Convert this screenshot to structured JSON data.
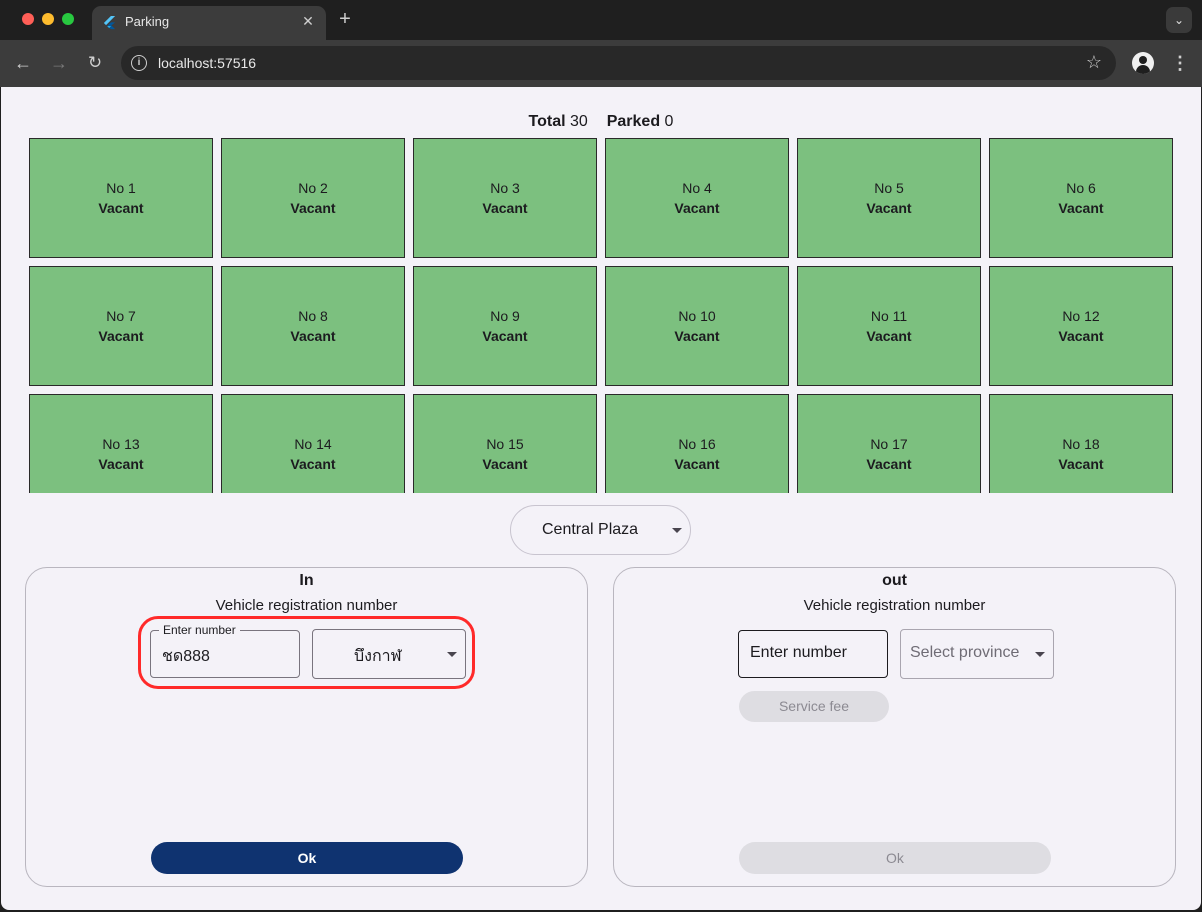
{
  "browser": {
    "tab_title": "Parking",
    "tab_close": "✕",
    "new_tab": "+",
    "tab_menu": "⌄",
    "url": "localhost:57516",
    "info_icon": "i",
    "star": "☆",
    "back": "←",
    "forward": "→",
    "reload": "↻",
    "menu": "⋮"
  },
  "summary": {
    "total_label": "Total",
    "total_value": "30",
    "parked_label": "Parked",
    "parked_value": "0"
  },
  "slots": [
    {
      "no": "No 1",
      "status": "Vacant"
    },
    {
      "no": "No 2",
      "status": "Vacant"
    },
    {
      "no": "No 3",
      "status": "Vacant"
    },
    {
      "no": "No 4",
      "status": "Vacant"
    },
    {
      "no": "No 5",
      "status": "Vacant"
    },
    {
      "no": "No 6",
      "status": "Vacant"
    },
    {
      "no": "No 7",
      "status": "Vacant"
    },
    {
      "no": "No 8",
      "status": "Vacant"
    },
    {
      "no": "No 9",
      "status": "Vacant"
    },
    {
      "no": "No 10",
      "status": "Vacant"
    },
    {
      "no": "No 11",
      "status": "Vacant"
    },
    {
      "no": "No 12",
      "status": "Vacant"
    },
    {
      "no": "No 13",
      "status": "Vacant"
    },
    {
      "no": "No 14",
      "status": "Vacant"
    },
    {
      "no": "No 15",
      "status": "Vacant"
    },
    {
      "no": "No 16",
      "status": "Vacant"
    },
    {
      "no": "No 17",
      "status": "Vacant"
    },
    {
      "no": "No 18",
      "status": "Vacant"
    }
  ],
  "location": {
    "selected": "Central Plaza"
  },
  "in_panel": {
    "title": "In",
    "subtitle": "Vehicle registration number",
    "number_label": "Enter number",
    "number_value": "ชด888",
    "province_value": "บึงกาฬ",
    "ok_label": "Ok"
  },
  "out_panel": {
    "title": "out",
    "subtitle": "Vehicle registration number",
    "number_placeholder": "Enter number",
    "province_placeholder": "Select province",
    "fee_label": "Service fee",
    "ok_label": "Ok"
  },
  "colors": {
    "slot_vacant": "#7cc07f",
    "ok_active": "#0f3370",
    "highlight": "#ff2a2a",
    "background": "#f4f2f8"
  }
}
